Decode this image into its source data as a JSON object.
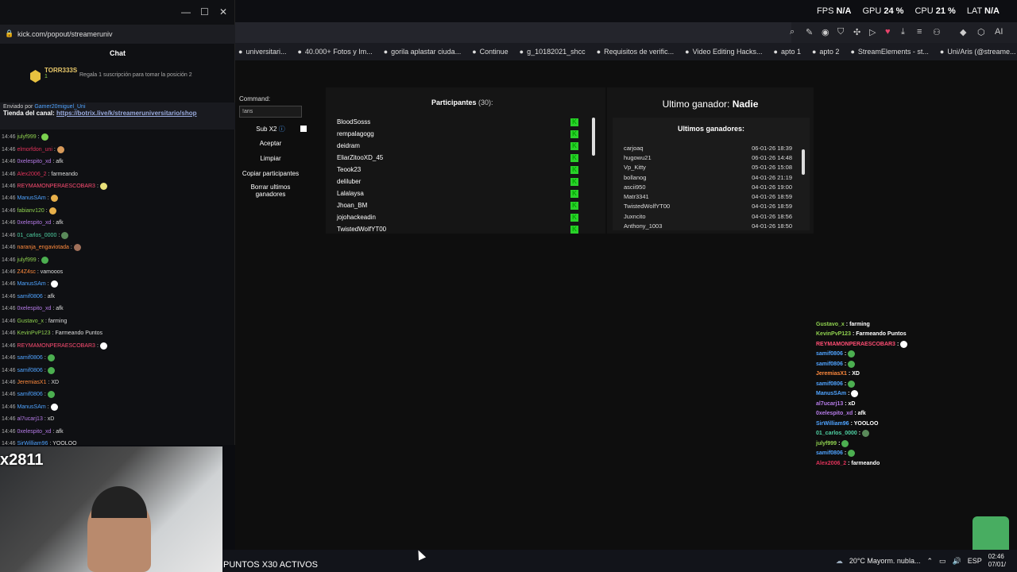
{
  "system": {
    "fps_label": "FPS",
    "fps": "N/A",
    "gpu_label": "GPU",
    "gpu": "24 %",
    "cpu_label": "CPU",
    "cpu": "21 %",
    "lat_label": "LAT",
    "lat": "N/A"
  },
  "bookmarks": [
    "universitari...",
    "40.000+ Fotos y Im...",
    "gorila aplastar ciuda...",
    "Continue",
    "g_10182021_shcc",
    "Requisitos de verific...",
    "Video Editing Hacks...",
    "apto 1",
    "apto 2",
    "StreamElements - st...",
    "Uni/Aris (@streame..."
  ],
  "popout": {
    "url": "kick.com/popout/streameruniv",
    "chat_title": "Chat",
    "gifter": "TORR333S",
    "gifter_count": "1",
    "gift_msg": "Regala 1 suscripción para tomar la posición 2",
    "pinned_by": "Enviado por",
    "pinned_user": "Gamer20miguel_Uni",
    "pinned_text": "Tienda del canal:",
    "pinned_link": "https://botrix.live/k/streameruniversitario/shop"
  },
  "chat": [
    {
      "time": "14:46",
      "user": "julyf999",
      "color": "#8fd14f",
      "text": ":",
      "emote": "#7bd14f"
    },
    {
      "time": "14:46",
      "user": "elmorfdon_uni",
      "color": "#e0325a",
      "text": ":",
      "emote": "#d89a5a"
    },
    {
      "time": "14:46",
      "user": "0xelespito_xd",
      "color": "#b67be8",
      "text": ": afk",
      "emote": ""
    },
    {
      "time": "14:46",
      "user": "Alex2006_2",
      "color": "#e0325a",
      "text": ": farmeando",
      "emote": ""
    },
    {
      "time": "14:46",
      "user": "REYMAMONPERAESCOBAR3",
      "color": "#ff4d73",
      "text": ":",
      "emote": "#e8e07a"
    },
    {
      "time": "14:46",
      "user": "ManusSAm",
      "color": "#4fa3ff",
      "text": ":",
      "emote": "#e8b04a"
    },
    {
      "time": "14:46",
      "user": "fabianv120",
      "color": "#8fd14f",
      "text": ":",
      "emote": "#e8b04a"
    },
    {
      "time": "14:46",
      "user": "0xelespito_xd",
      "color": "#b67be8",
      "text": ": afk",
      "emote": ""
    },
    {
      "time": "14:46",
      "user": "01_carlos_0000",
      "color": "#4fd1a3",
      "text": ":",
      "emote": "#5a8a5a"
    },
    {
      "time": "14:46",
      "user": "naranja_engaviotada",
      "color": "#ff8a3d",
      "text": ":",
      "emote": "#a0705a"
    },
    {
      "time": "14:46",
      "user": "julyf999",
      "color": "#8fd14f",
      "text": ":",
      "emote": "#4caf50"
    },
    {
      "time": "14:46",
      "user": "Z4Z4sc",
      "color": "#ff8a3d",
      "text": ": vamooos",
      "emote": ""
    },
    {
      "time": "14:46",
      "user": "ManusSAm",
      "color": "#4fa3ff",
      "text": ":",
      "emote": "#ffffff"
    },
    {
      "time": "14:46",
      "user": "samif0806",
      "color": "#4fa3ff",
      "text": ": afk",
      "emote": ""
    },
    {
      "time": "14:46",
      "user": "0xelespito_xd",
      "color": "#b67be8",
      "text": ": afk",
      "emote": ""
    },
    {
      "time": "14:46",
      "user": "Gustavo_x",
      "color": "#8fd14f",
      "text": ": farming",
      "emote": ""
    },
    {
      "time": "14:46",
      "user": "KevinPvP123",
      "color": "#8fd14f",
      "text": ": Farmeando Puntos",
      "emote": ""
    },
    {
      "time": "14:46",
      "user": "REYMAMONPERAESCOBAR3",
      "color": "#ff4d73",
      "text": ":",
      "emote": "#ffffff"
    },
    {
      "time": "14:46",
      "user": "samif0806",
      "color": "#4fa3ff",
      "text": ":",
      "emote": "#4caf50"
    },
    {
      "time": "14:46",
      "user": "samif0806",
      "color": "#4fa3ff",
      "text": ":",
      "emote": "#4caf50"
    },
    {
      "time": "14:46",
      "user": "JeremiasX1",
      "color": "#ff8a3d",
      "text": ": XD",
      "emote": ""
    },
    {
      "time": "14:46",
      "user": "samif0806",
      "color": "#4fa3ff",
      "text": ":",
      "emote": "#4caf50"
    },
    {
      "time": "14:46",
      "user": "ManusSAm",
      "color": "#4fa3ff",
      "text": ":",
      "emote": "#ffffff"
    },
    {
      "time": "14:46",
      "user": "al7ucarj13",
      "color": "#b67be8",
      "text": ": xD",
      "emote": ""
    },
    {
      "time": "14:46",
      "user": "0xelespito_xd",
      "color": "#b67be8",
      "text": ": afk",
      "emote": ""
    },
    {
      "time": "14:46",
      "user": "SirWilliam96",
      "color": "#4fa3ff",
      "text": ": YOOLOO",
      "emote": ""
    }
  ],
  "app": {
    "command_label": "Command:",
    "command_value": "!aris",
    "sub_x2": "Sub X2",
    "accept": "Aceptar",
    "clear": "Limpiar",
    "copy": "Copiar participantes",
    "delete": "Borrar ultimos ganadores",
    "participants_title": "Participantes",
    "participants_count": "(30):",
    "participants": [
      "BloodSosss",
      "rempalagogg",
      "deidram",
      "EliarZitooXD_45",
      "Teook23",
      "deliluber",
      "Lalalaysa",
      "Jhoan_BM",
      "jojohackeadin",
      "TwistedWolfYT00"
    ],
    "last_winner_label": "Ultimo ganador:",
    "last_winner": "Nadie",
    "winners_title": "Ultimos ganadores:",
    "winners": [
      {
        "name": "carjoaq",
        "date": "06-01-26 18:39"
      },
      {
        "name": "hugowu21",
        "date": "06-01-26 14:48"
      },
      {
        "name": "Vp_Kitty",
        "date": "05-01-26 15:08"
      },
      {
        "name": "bollanog",
        "date": "04-01-26 21:19"
      },
      {
        "name": "ascii950",
        "date": "04-01-26 19:00"
      },
      {
        "name": "Matr3341",
        "date": "04-01-26 18:59"
      },
      {
        "name": "TwistedWolfYT00",
        "date": "04-01-26 18:59"
      },
      {
        "name": "Juxncito",
        "date": "04-01-26 18:56"
      },
      {
        "name": "Anthony_1003",
        "date": "04-01-26 18:50"
      }
    ]
  },
  "overlay_chat": [
    {
      "user": "Gustavo_x",
      "color": "#8fd14f",
      "text": ": farming",
      "emote": ""
    },
    {
      "user": "KevinPvP123",
      "color": "#8fd14f",
      "text": ": Farmeando Puntos",
      "emote": ""
    },
    {
      "user": "REYMAMONPERAESCOBAR3",
      "color": "#ff4d73",
      "text": ":",
      "emote": "#ffffff"
    },
    {
      "user": "samif0806",
      "color": "#4fa3ff",
      "text": ":",
      "emote": "#4caf50"
    },
    {
      "user": "samif0806",
      "color": "#4fa3ff",
      "text": ":",
      "emote": "#4caf50"
    },
    {
      "user": "JeremiasX1",
      "color": "#ff8a3d",
      "text": ": XD",
      "emote": ""
    },
    {
      "user": "samif0806",
      "color": "#4fa3ff",
      "text": ":",
      "emote": "#4caf50"
    },
    {
      "user": "ManusSAm",
      "color": "#4fa3ff",
      "text": ":",
      "emote": "#ffffff"
    },
    {
      "user": "al7ucarj13",
      "color": "#b67be8",
      "text": ": xD",
      "emote": ""
    },
    {
      "user": "0xelespito_xd",
      "color": "#b67be8",
      "text": ": afk",
      "emote": ""
    },
    {
      "user": "SirWilliam96",
      "color": "#4fa3ff",
      "text": ": YOOLOO",
      "emote": ""
    },
    {
      "user": "01_carlos_0000",
      "color": "#4fd1a3",
      "text": ":",
      "emote": "#5a8a5a"
    },
    {
      "user": "julyf999",
      "color": "#8fd14f",
      "text": ":",
      "emote": "#4caf50"
    },
    {
      "user": "samif0806",
      "color": "#4fa3ff",
      "text": ":",
      "emote": "#4caf50"
    },
    {
      "user": "Alex2006_2",
      "color": "#e0325a",
      "text": ": farmeando",
      "emote": ""
    }
  ],
  "stream": {
    "counter": "x2811",
    "puntos": "PUNTOS X30 ACTIVOS"
  },
  "taskbar": {
    "weather": "20°C  Mayorm. nubla...",
    "lang": "ESP",
    "time": "02:46",
    "date": "07/01/"
  }
}
